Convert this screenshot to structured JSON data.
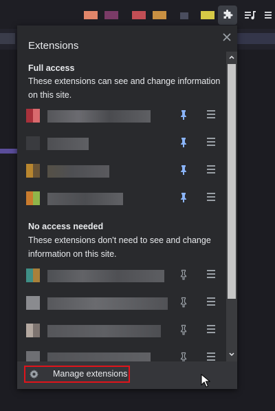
{
  "popup": {
    "title": "Extensions",
    "close_icon": "close-icon"
  },
  "sections": [
    {
      "heading": "Full access",
      "description": "These extensions can see and change information on this site.",
      "pin_state": "pinned",
      "pin_color": "#8ab4f8",
      "item_count": 4
    },
    {
      "heading": "No access needed",
      "description": "These extensions don't need to see and change information on this site.",
      "pin_state": "unpinned",
      "pin_color": "#9aa0a6",
      "item_count": 4
    }
  ],
  "footer": {
    "manage_label": "Manage extensions",
    "manage_icon": "gear-icon",
    "highlight_color": "#e0141b"
  },
  "toolbar": {
    "extensions_icon": "puzzle-icon",
    "media_icon": "media-control-icon",
    "menu_icon": "kebab-menu-icon"
  },
  "colors": {
    "popup_background": "#292a2d",
    "pinned_icon": "#8ab4f8"
  }
}
